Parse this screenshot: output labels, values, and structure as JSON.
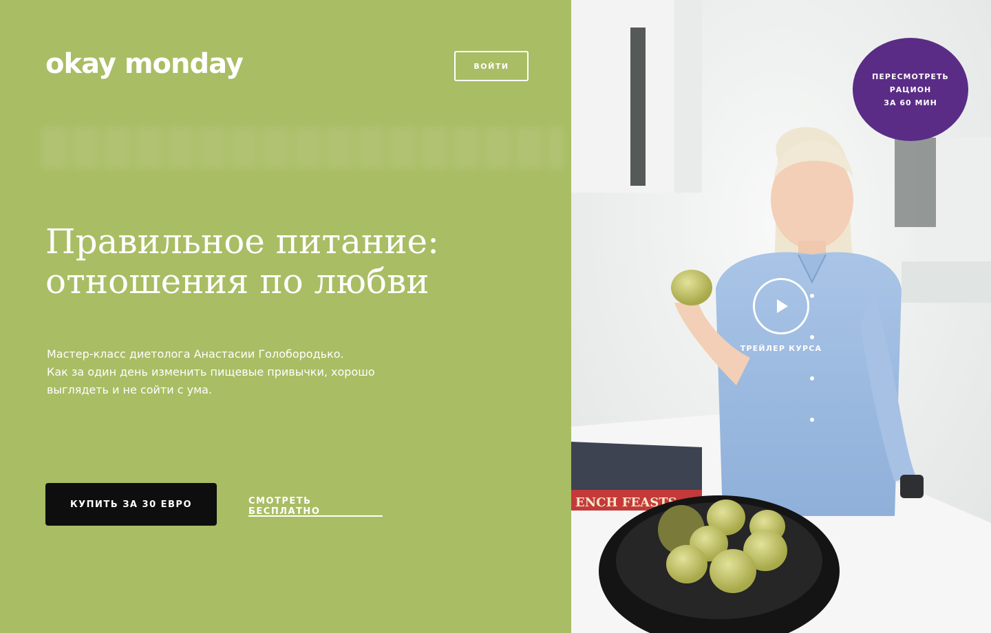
{
  "brand": {
    "logo_text": "okay monday"
  },
  "header": {
    "login_label": "ВОЙТИ"
  },
  "hero": {
    "title_line1": "Правильное питание:",
    "title_line2": "отношения по любви",
    "desc_line1": "Мастер-класс  диетолога Анастасии Голобородько.",
    "desc_line2": "Как за один день изменить пищевые привычки, хорошо",
    "desc_line3": "выглядеть и не сойти с ума."
  },
  "actions": {
    "buy_label": "КУПИТЬ ЗА 30 ЕВРО",
    "free_label": "СМОТРЕТЬ БЕСПЛАТНО"
  },
  "badge": {
    "line1": "ПЕРЕСМОТРЕТЬ",
    "line2": "РАЦИОН",
    "line3": "ЗА 60 МИН"
  },
  "video": {
    "trailer_label": "ТРЕЙЛЕР КУРСА"
  },
  "photo": {
    "book_spine_text": "ENCH FEASTS"
  },
  "colors": {
    "background": "#a9bd64",
    "badge": "#5a2c86",
    "button_dark": "#0e0e0e",
    "text": "#ffffff"
  },
  "icons": [
    "play-icon"
  ]
}
